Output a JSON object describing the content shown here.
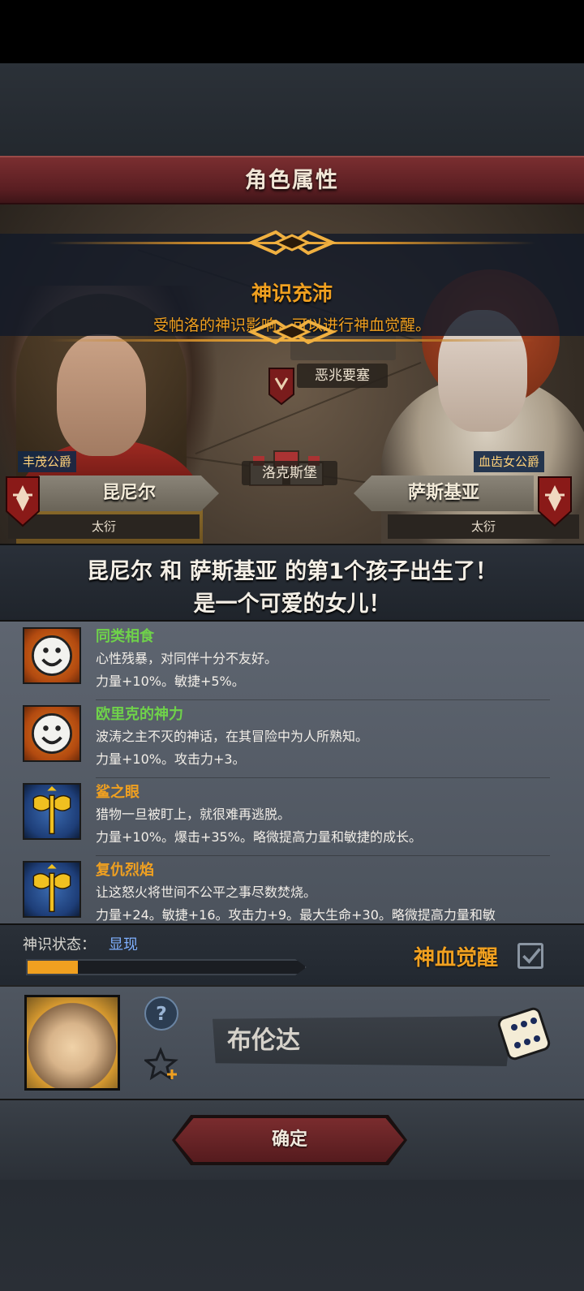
{
  "title": "角色属性",
  "banner": {
    "title": "神识充沛",
    "subtitle": "受帕洛的神识影响，可以进行神血觉醒。"
  },
  "map": {
    "location_top": "恶兆要塞",
    "location_center": "洛克斯堡"
  },
  "father": {
    "title": "丰茂公爵",
    "name": "昆尼尔",
    "sub": "太衍"
  },
  "mother": {
    "title": "血齿女公爵",
    "name": "萨斯基亚",
    "sub": "太衍"
  },
  "message": {
    "line1": "昆尼尔 和 萨斯基亚 的第1个孩子出生了！",
    "line2": "是一个可爱的女儿！"
  },
  "traits": [
    {
      "icon": "smiley-icon",
      "name": "同类相食",
      "name_color": "#6fd24a",
      "desc": "心性残暴，对同伴十分不友好。",
      "stats": "力量+10%。敏捷+5%。"
    },
    {
      "icon": "smiley-icon",
      "name": "欧里克的神力",
      "name_color": "#6fd24a",
      "desc": "波涛之主不灭的神话，在其冒险中为人所熟知。",
      "stats": "力量+10%。攻击力+3。"
    },
    {
      "icon": "axe-icon",
      "name": "鲨之眼",
      "name_color": "#f0a020",
      "desc": "猎物一旦被盯上，就很难再逃脱。",
      "stats": "力量+10%。爆击+35%。略微提高力量和敏捷的成长。"
    },
    {
      "icon": "axe-icon",
      "name": "复仇烈焰",
      "name_color": "#f0a020",
      "desc": "让这怒火将世间不公平之事尽数焚烧。",
      "stats": "力量+24。敏捷+16。攻击力+9。最大生命+30。略微提高力量和敏"
    }
  ],
  "status": {
    "label": "神识状态：",
    "value": "显现",
    "progress": 0.18,
    "awaken_label": "神血觉醒",
    "awaken_checked": true
  },
  "naming": {
    "name_value": "布伦达"
  },
  "confirm_label": "确定",
  "colors": {
    "accent_gold": "#f0a020",
    "title_red": "#6a2428",
    "link_blue": "#7fb0ff",
    "trait_green": "#6fd24a"
  }
}
